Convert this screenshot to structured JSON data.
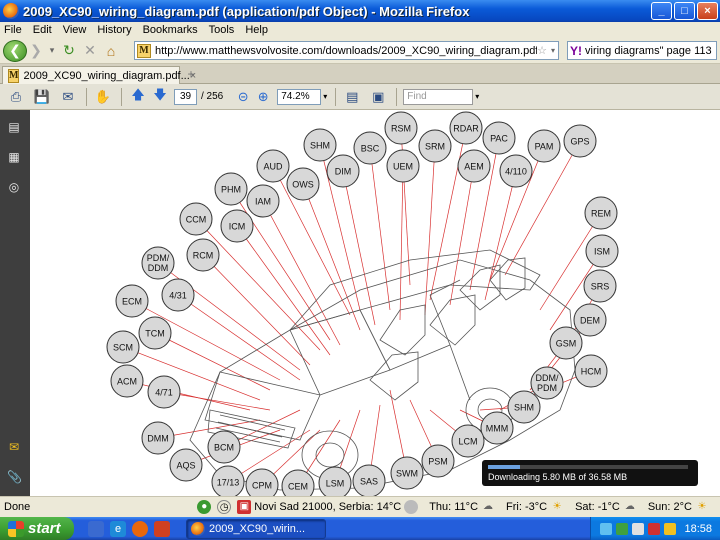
{
  "window": {
    "title": "2009_XC90_wiring_diagram.pdf (application/pdf Object) - Mozilla Firefox",
    "minimize_label": "_",
    "maximize_label": "□",
    "close_label": "×"
  },
  "menu": {
    "items": [
      "File",
      "Edit",
      "View",
      "History",
      "Bookmarks",
      "Tools",
      "Help"
    ],
    "accel": [
      "F",
      "E",
      "V",
      "H",
      "B",
      "T",
      "H"
    ]
  },
  "nav": {
    "url": "http://www.matthewsvolvosite.com/downloads/2009_XC90_wiring_diagram.pdf",
    "site_badge": "M",
    "search_text": "viring diagrams\" page 113",
    "search_engine_icon": "Y!"
  },
  "tab": {
    "label": "2009_XC90_wiring_diagram.pdf...",
    "badge": "M",
    "close": "×",
    "new_tab": "+"
  },
  "pdf_toolbar": {
    "current_page": "39",
    "total_pages": "/ 256",
    "zoom": "74.2%",
    "find_placeholder": "Find"
  },
  "diagram": {
    "modules": [
      "SHM",
      "RSM",
      "RDAR",
      "BSC",
      "SRM",
      "PAC",
      "GPS",
      "PAM",
      "AUD",
      "DIM",
      "UEM",
      "AEM",
      "OWS",
      "4/110",
      "PHM",
      "IAM",
      "REM",
      "CCM",
      "ICM",
      "ISM",
      "PDM/ DDM",
      "RCM",
      "SRS",
      "ECM",
      "4/31",
      "DEM",
      "TCM",
      "SCM",
      "GSM",
      "HCM",
      "ACM",
      "4/71",
      "DDM/ PDM",
      "SHM",
      "MMM",
      "DMM",
      "LCM",
      "PSM",
      "BCM",
      "AQS",
      "SWM",
      "17/13",
      "CPM",
      "CEM",
      "LSM",
      "SAS"
    ]
  },
  "download": {
    "text": "Downloading 5.80 MB of 36.58 MB",
    "progress": 0.159
  },
  "status": {
    "done": "Done",
    "weather": [
      {
        "label": "Novi Sad 21000, Serbia: 14°C"
      },
      {
        "label": "Thu: 11°C"
      },
      {
        "label": "Fri: -3°C"
      },
      {
        "label": "Sat: -1°C"
      },
      {
        "label": "Sun: 2°C"
      }
    ]
  },
  "taskbar": {
    "start_label": "start",
    "task_label": "2009_XC90_wirin...",
    "clock": "18:58"
  }
}
